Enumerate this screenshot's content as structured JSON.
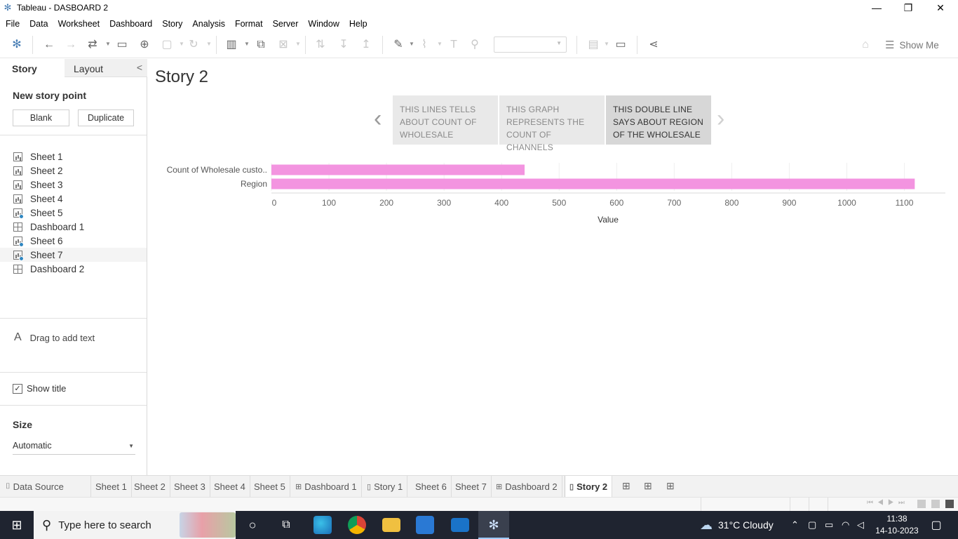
{
  "window": {
    "title": "Tableau - DASBOARD 2",
    "controls": {
      "minimize": "—",
      "restore": "❐",
      "close": "✕"
    }
  },
  "menu": [
    "File",
    "Data",
    "Worksheet",
    "Dashboard",
    "Story",
    "Analysis",
    "Format",
    "Server",
    "Window",
    "Help"
  ],
  "toolbar": {
    "show_me_label": "Show Me",
    "icons": [
      "tableau-logo-icon",
      "undo-icon",
      "redo-icon",
      "swap-icon",
      "save-icon",
      "new-datasource-icon",
      "pause-update-icon",
      "refresh-icon",
      "new-worksheet-icon",
      "duplicate-icon",
      "clear-icon",
      "swap-rows-icon",
      "sort-ascending-icon",
      "sort-descending-icon",
      "highlight-icon",
      "group-icon",
      "label-icon",
      "pin-icon",
      "fit-icon",
      "presentation-icon",
      "share-icon",
      "format-painter-icon"
    ]
  },
  "left_panel": {
    "tabs": {
      "story": "Story",
      "layout": "Layout",
      "collapse": "<"
    },
    "new_story_point": "New story point",
    "blank_button": "Blank",
    "duplicate_button": "Duplicate",
    "sheets": [
      {
        "label": "Sheet 1",
        "type": "worksheet",
        "used": false
      },
      {
        "label": "Sheet 2",
        "type": "worksheet",
        "used": false
      },
      {
        "label": "Sheet 3",
        "type": "worksheet",
        "used": false
      },
      {
        "label": "Sheet 4",
        "type": "worksheet",
        "used": false
      },
      {
        "label": "Sheet 5",
        "type": "worksheet",
        "used": true
      },
      {
        "label": "Dashboard 1",
        "type": "dashboard",
        "used": false
      },
      {
        "label": "Sheet 6",
        "type": "worksheet",
        "used": true
      },
      {
        "label": "Sheet 7",
        "type": "worksheet",
        "used": true
      },
      {
        "label": "Dashboard 2",
        "type": "dashboard",
        "used": false
      }
    ],
    "drag_text": "Drag to add text",
    "drag_text_icon": "A",
    "show_title": {
      "label": "Show title",
      "checked": true,
      "mark": "✓"
    },
    "size_heading": "Size",
    "size_value": "Automatic"
  },
  "story": {
    "title": "Story 2",
    "points": [
      {
        "text": "THIS LINES TELLS ABOUT COUNT OF WHOLESALE",
        "active": false
      },
      {
        "text": "THIS GRAPH REPRESENTS  THE COUNT OF CHANNELS",
        "active": false
      },
      {
        "text": "THIS DOUBLE LINE SAYS ABOUT REGION OF THE WHOLESALE",
        "active": true
      }
    ],
    "nav_prev": "‹",
    "nav_next": "›"
  },
  "chart_data": {
    "type": "bar",
    "orientation": "horizontal",
    "categories": [
      "Count of Wholesale custo..",
      "Region"
    ],
    "values": [
      440,
      1118
    ],
    "xlabel": "Value",
    "ylabel": "",
    "xlim": [
      0,
      1170
    ],
    "ticks": [
      0,
      100,
      200,
      300,
      400,
      500,
      600,
      700,
      800,
      900,
      1000,
      1100
    ],
    "bar_color": "#f394e0",
    "grid": true
  },
  "sheet_tabs": [
    {
      "label": "Data Source",
      "icon": "database-icon",
      "glyph": "⌷",
      "active": false
    },
    {
      "label": "Sheet 1",
      "active": false
    },
    {
      "label": "Sheet 2",
      "active": false
    },
    {
      "label": "Sheet 3",
      "active": false
    },
    {
      "label": "Sheet 4",
      "active": false
    },
    {
      "label": "Sheet 5",
      "active": false
    },
    {
      "label": "Dashboard 1",
      "icon": "dashboard-icon",
      "glyph": "⊞",
      "active": false
    },
    {
      "label": "Story 1",
      "icon": "story-icon",
      "glyph": "▯",
      "active": false
    },
    {
      "label": "Sheet 6",
      "active": false
    },
    {
      "label": "Sheet 7",
      "active": false
    },
    {
      "label": "Dashboard 2",
      "icon": "dashboard-icon",
      "glyph": "⊞",
      "active": false
    },
    {
      "label": "Story 2",
      "icon": "story-icon",
      "glyph": "▯",
      "active": true
    }
  ],
  "taskbar": {
    "search_placeholder": "Type here to search",
    "weather": "31°C  Cloudy",
    "time": "11:38",
    "date": "14-10-2023"
  }
}
